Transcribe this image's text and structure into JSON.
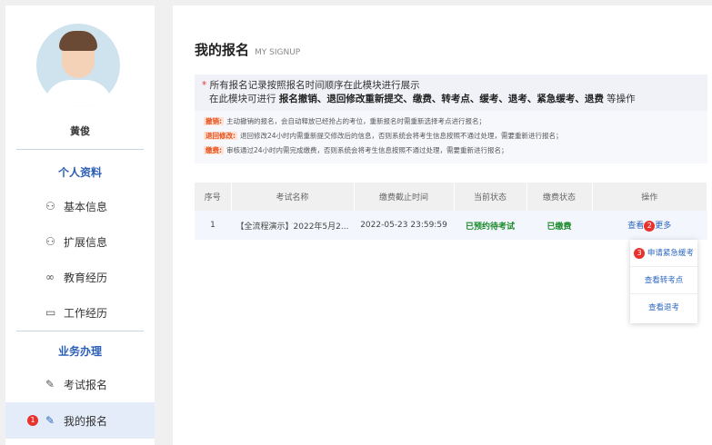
{
  "user": {
    "name": "黄俊"
  },
  "sidebar": {
    "section1": "个人资料",
    "section2": "业务办理",
    "items": [
      {
        "label": "基本信息",
        "icon": "user-icon"
      },
      {
        "label": "扩展信息",
        "icon": "user-icon"
      },
      {
        "label": "教育经历",
        "icon": "glasses-icon"
      },
      {
        "label": "工作经历",
        "icon": "briefcase-icon"
      },
      {
        "label": "考试报名",
        "icon": "pencil-icon"
      },
      {
        "label": "我的报名",
        "icon": "edit-icon",
        "active": true,
        "badge": "1"
      }
    ]
  },
  "page": {
    "title": "我的报名",
    "subtitle": "MY SIGNUP"
  },
  "notice": {
    "line1": "所有报名记录按照报名时间顺序在此模块进行展示",
    "line2_prefix": "在此模块可进行 ",
    "line2_bold": "报名撤销、退回修改重新提交、缴费、转考点、缓考、退考、紧急缓考、退费",
    "line2_suffix": " 等操作"
  },
  "rules": [
    {
      "tag": "撤销:",
      "text": "主动撤销的报名，会自动释放已经抢占的考位，重新报名时需重新选择考点进行报名；"
    },
    {
      "tag": "退回修改:",
      "text": "退回修改24小时内需重新提交修改后的信息，否则系统会将考生信息按照不通过处理，需要重新进行报名；"
    },
    {
      "tag": "缴费:",
      "text": "审核通过24小时内需完成缴费，否则系统会将考生信息按照不通过处理，需要重新进行报名；"
    }
  ],
  "table": {
    "headers": [
      "序号",
      "考试名称",
      "缴费截止时间",
      "当前状态",
      "缴费状态",
      "操作"
    ],
    "rows": [
      {
        "index": "1",
        "name": "【全流程演示】2022年5月2...",
        "deadline": "2022-05-23 23:59:59",
        "status": "已预约待考试",
        "pay": "已缴费",
        "view": "查看",
        "more": "更多",
        "badge": "2"
      }
    ]
  },
  "menu": {
    "badge": "3",
    "items": [
      "申请紧急缓考",
      "查看转考点",
      "查看退考"
    ]
  }
}
